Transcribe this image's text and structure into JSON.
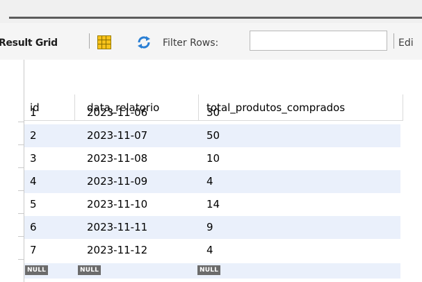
{
  "toolbar": {
    "result_grid_label": "Result Grid",
    "filter_label": "Filter Rows:",
    "filter_value": "",
    "edit_label": "Edi"
  },
  "icons": {
    "grid": "grid-icon",
    "refresh": "refresh-icon"
  },
  "colors": {
    "row_alt": "#eaf0fb",
    "grid_icon": "#f7c21a",
    "refresh_icon": "#2a7fd4"
  },
  "table": {
    "columns": [
      "id",
      "data_relatorio",
      "total_produtos_comprados"
    ],
    "rows": [
      [
        "1",
        "2023-11-06",
        "30"
      ],
      [
        "2",
        "2023-11-07",
        "50"
      ],
      [
        "3",
        "2023-11-08",
        "10"
      ],
      [
        "4",
        "2023-11-09",
        "4"
      ],
      [
        "5",
        "2023-11-10",
        "14"
      ],
      [
        "6",
        "2023-11-11",
        "9"
      ],
      [
        "7",
        "2023-11-12",
        "4"
      ]
    ],
    "null_row": [
      "NULL",
      "NULL",
      "NULL"
    ]
  }
}
